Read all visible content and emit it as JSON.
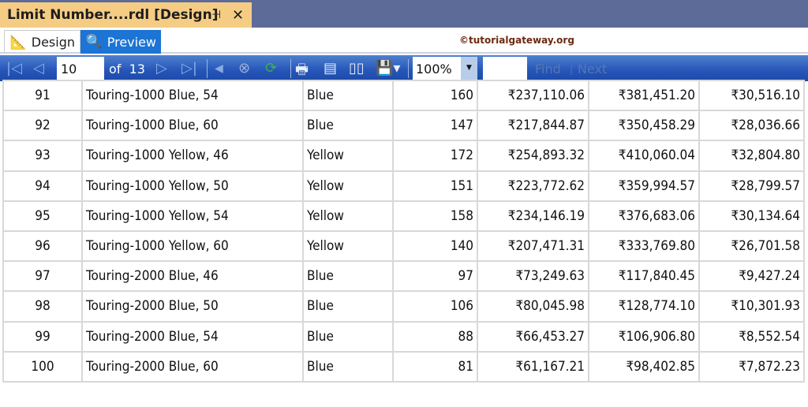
{
  "window": {
    "tab_title": "Limit  Number....rdl [Design]",
    "pin": "⊣",
    "close": "✕"
  },
  "modes": {
    "design": "Design",
    "preview": "Preview"
  },
  "watermark": "©tutorialgateway.org",
  "toolbar": {
    "page": "10",
    "of_label": "of",
    "total_pages": "13",
    "zoom": "100%",
    "find_value": "",
    "find": "Find",
    "next": "Next"
  },
  "rows": [
    [
      "91",
      "Touring-1000 Blue, 54",
      "Blue",
      "160",
      "₹237,110.06",
      "₹381,451.20",
      "₹30,516.10"
    ],
    [
      "92",
      "Touring-1000 Blue, 60",
      "Blue",
      "147",
      "₹217,844.87",
      "₹350,458.29",
      "₹28,036.66"
    ],
    [
      "93",
      "Touring-1000 Yellow, 46",
      "Yellow",
      "172",
      "₹254,893.32",
      "₹410,060.04",
      "₹32,804.80"
    ],
    [
      "94",
      "Touring-1000 Yellow, 50",
      "Yellow",
      "151",
      "₹223,772.62",
      "₹359,994.57",
      "₹28,799.57"
    ],
    [
      "95",
      "Touring-1000 Yellow, 54",
      "Yellow",
      "158",
      "₹234,146.19",
      "₹376,683.06",
      "₹30,134.64"
    ],
    [
      "96",
      "Touring-1000 Yellow, 60",
      "Yellow",
      "140",
      "₹207,471.31",
      "₹333,769.80",
      "₹26,701.58"
    ],
    [
      "97",
      "Touring-2000 Blue, 46",
      "Blue",
      "97",
      "₹73,249.63",
      "₹117,840.45",
      "₹9,427.24"
    ],
    [
      "98",
      "Touring-2000 Blue, 50",
      "Blue",
      "106",
      "₹80,045.98",
      "₹128,774.10",
      "₹10,301.93"
    ],
    [
      "99",
      "Touring-2000 Blue, 54",
      "Blue",
      "88",
      "₹66,453.27",
      "₹106,906.80",
      "₹8,552.54"
    ],
    [
      "100",
      "Touring-2000 Blue, 60",
      "Blue",
      "81",
      "₹61,167.21",
      "₹98,402.85",
      "₹7,872.23"
    ]
  ]
}
